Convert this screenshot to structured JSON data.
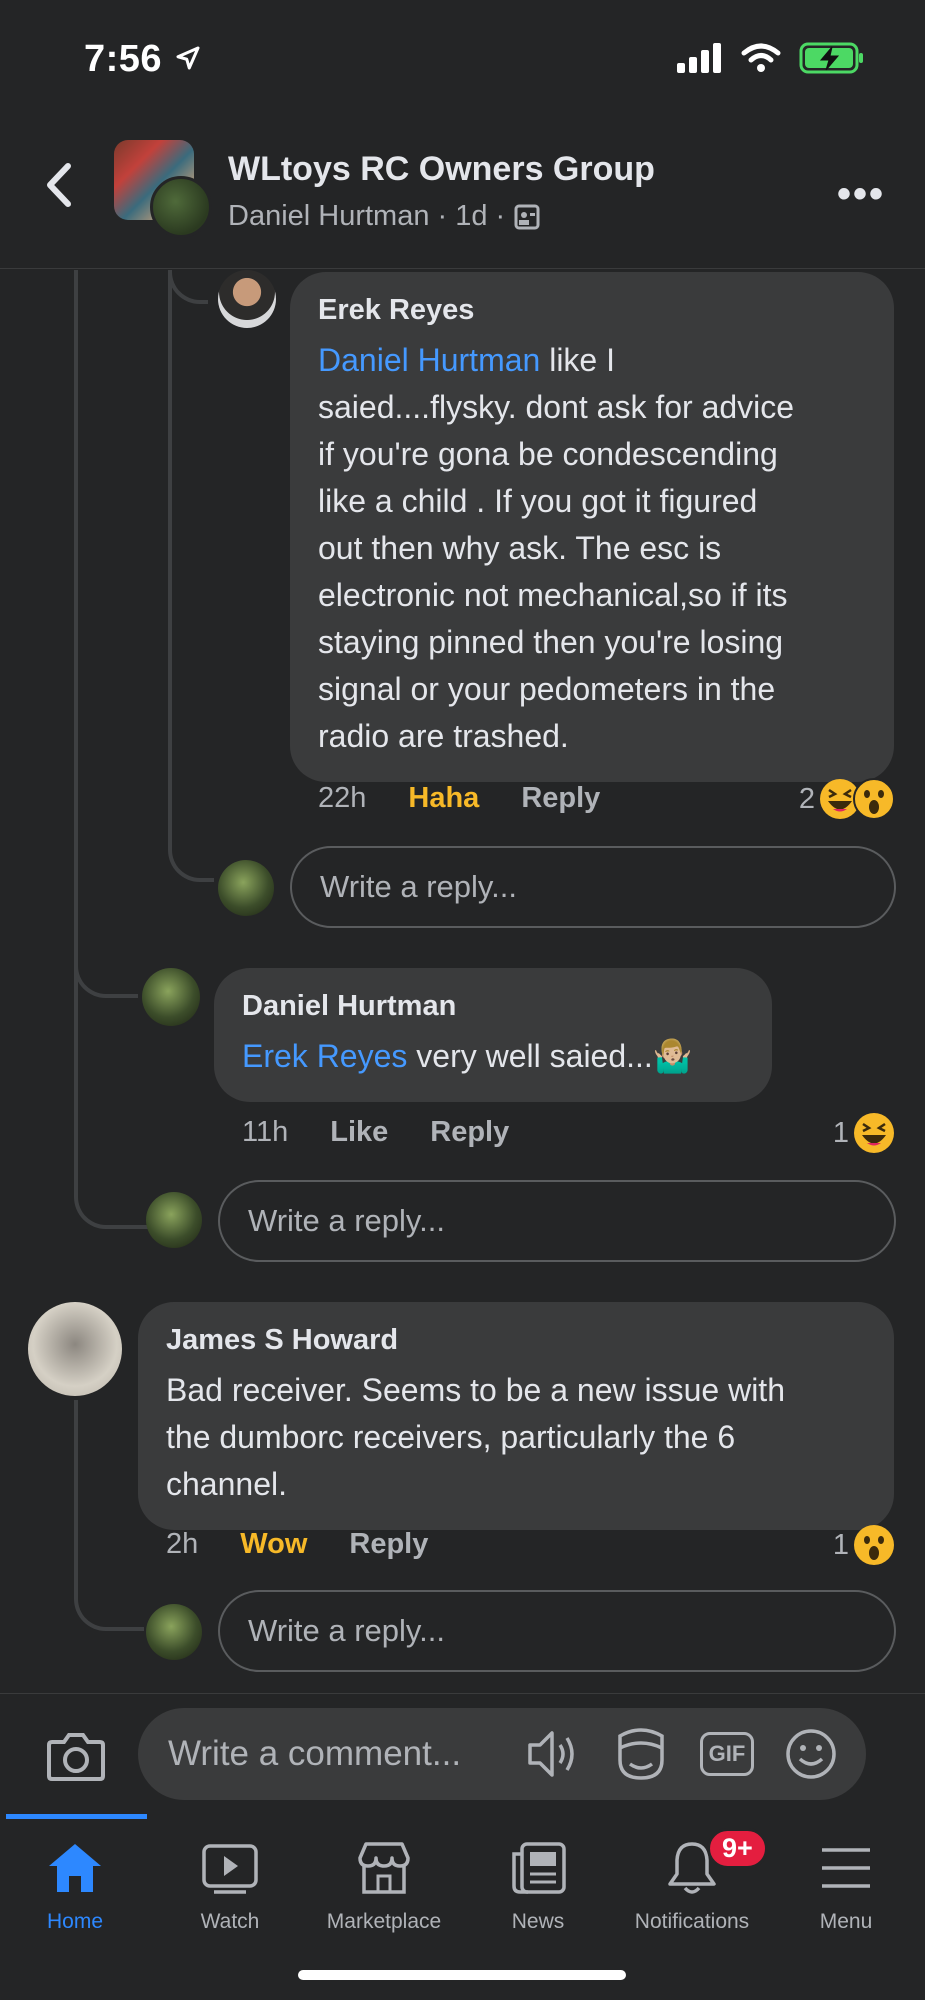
{
  "status": {
    "time": "7:56"
  },
  "header": {
    "title": "WLtoys RC Owners Group",
    "author": "Daniel Hurtman",
    "age": "· 1d ·"
  },
  "comments": {
    "erek": {
      "name": "Erek Reyes",
      "mention": "Daniel Hurtman",
      "text_lines": [
        " like I",
        "saied....flysky. dont ask for advice",
        "if you're gona be condescending",
        "like a child . If you got it figured",
        "out then why ask. The esc is",
        "electronic not mechanical,so if its",
        "staying pinned then you're losing",
        "signal or your pedometers in the",
        "radio are trashed."
      ],
      "time": "22h",
      "reaction": "Haha",
      "reply": "Reply",
      "count": "2"
    },
    "erek_reply_box": {
      "placeholder": "Write a reply..."
    },
    "daniel": {
      "name": "Daniel Hurtman",
      "mention": "Erek Reyes",
      "text": " very well saied...🤷🏼‍♂️",
      "time": "11h",
      "like": "Like",
      "reply": "Reply",
      "count": "1"
    },
    "daniel_reply_box": {
      "placeholder": "Write a reply..."
    },
    "james": {
      "name": "James S Howard",
      "text_lines": [
        "Bad receiver. Seems to be a new issue with",
        "the dumborc receivers, particularly the 6",
        "channel."
      ],
      "time": "2h",
      "reaction": "Wow",
      "reply": "Reply",
      "count": "1"
    },
    "james_reply_box": {
      "placeholder": "Write a reply..."
    }
  },
  "composer": {
    "placeholder": "Write a comment...",
    "gif": "GIF"
  },
  "tabs": [
    {
      "label": "Home",
      "icon": "home-icon"
    },
    {
      "label": "Watch",
      "icon": "watch-icon"
    },
    {
      "label": "Marketplace",
      "icon": "marketplace-icon"
    },
    {
      "label": "News",
      "icon": "news-icon"
    },
    {
      "label": "Notifications",
      "icon": "bell-icon"
    },
    {
      "label": "Menu",
      "icon": "menu-icon"
    }
  ],
  "notifications_badge": "9+",
  "colors": {
    "accent": "#2d88ff",
    "mention": "#4599ff",
    "reaction": "#f7b928",
    "badge": "#e41e3f"
  }
}
